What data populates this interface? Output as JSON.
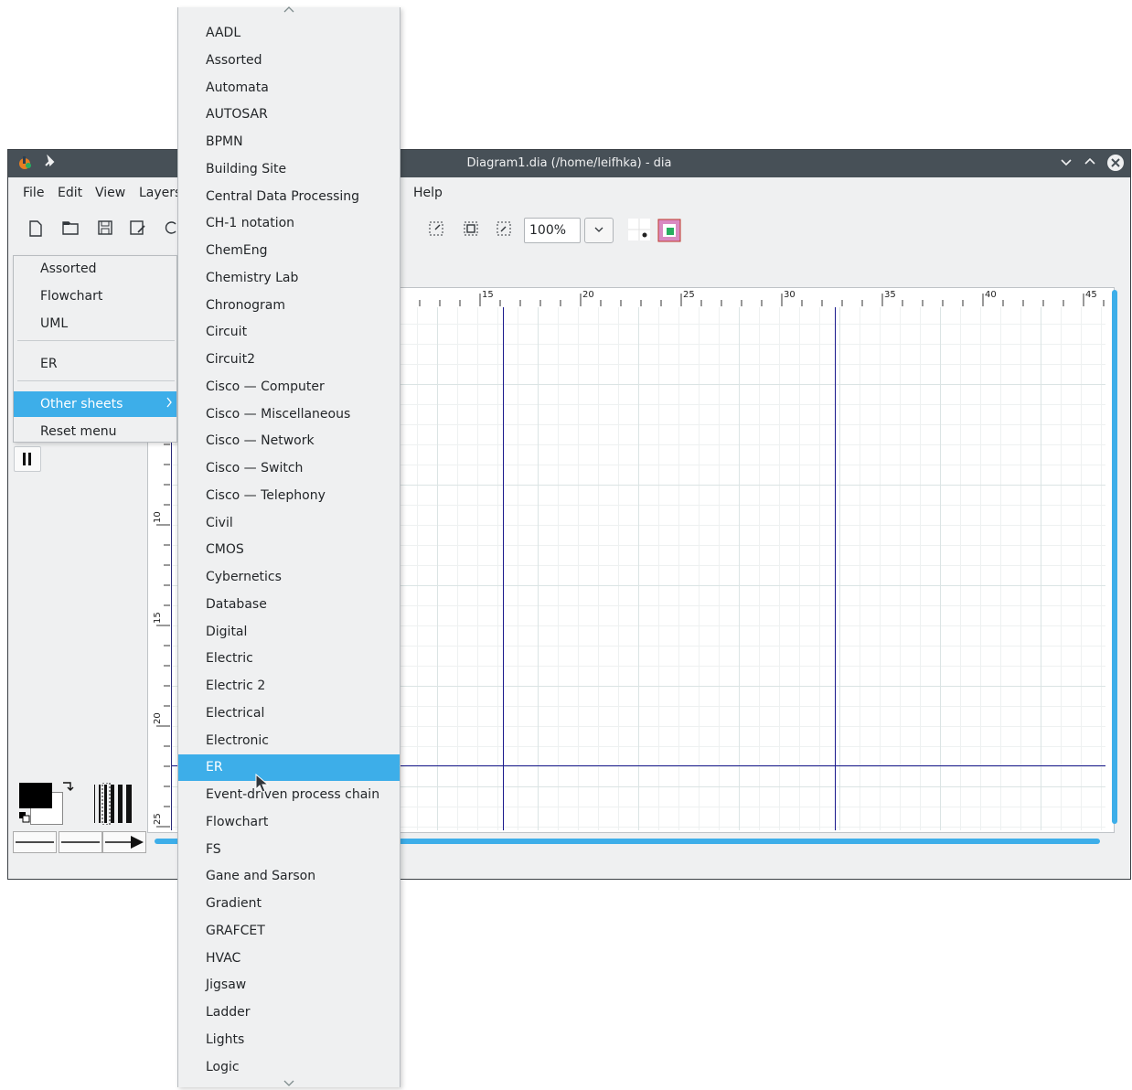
{
  "window": {
    "title": "Diagram1.dia (/home/leifhka) - dia",
    "pin_icon": "pin-icon",
    "controls": [
      "minimize-icon",
      "maximize-icon",
      "close-icon"
    ]
  },
  "menubar": {
    "items": [
      "File",
      "Edit",
      "View",
      "Layers",
      "Help"
    ]
  },
  "toolbar": {
    "zoom_value": "100%"
  },
  "ruler": {
    "horizontal": [
      "15",
      "20",
      "25",
      "30",
      "35",
      "40",
      "45"
    ],
    "vertical": [
      "10",
      "15",
      "20",
      "25"
    ]
  },
  "sheet_menu": {
    "items": [
      "Assorted",
      "Flowchart",
      "UML",
      "ER",
      "Other sheets",
      "Reset menu"
    ],
    "active": "Other sheets"
  },
  "other_sheets": {
    "items": [
      "AADL",
      "Assorted",
      "Automata",
      "AUTOSAR",
      "BPMN",
      "Building Site",
      "Central Data Processing",
      "CH-1 notation",
      "ChemEng",
      "Chemistry Lab",
      "Chronogram",
      "Circuit",
      "Circuit2",
      "Cisco — Computer",
      "Cisco — Miscellaneous",
      "Cisco — Network",
      "Cisco — Switch",
      "Cisco — Telephony",
      "Civil",
      "CMOS",
      "Cybernetics",
      "Database",
      "Digital",
      "Electric",
      "Electric 2",
      "Electrical",
      "Electronic",
      "ER",
      "Event-driven process chain",
      "Flowchart",
      "FS",
      "Gane and Sarson",
      "Gradient",
      "GRAFCET",
      "HVAC",
      "Jigsaw",
      "Ladder",
      "Lights",
      "Logic"
    ],
    "highlighted": "ER"
  },
  "colors": {
    "accent": "#3daee9",
    "titlebar": "#475057",
    "guide_lines": "#1a1a8c"
  }
}
